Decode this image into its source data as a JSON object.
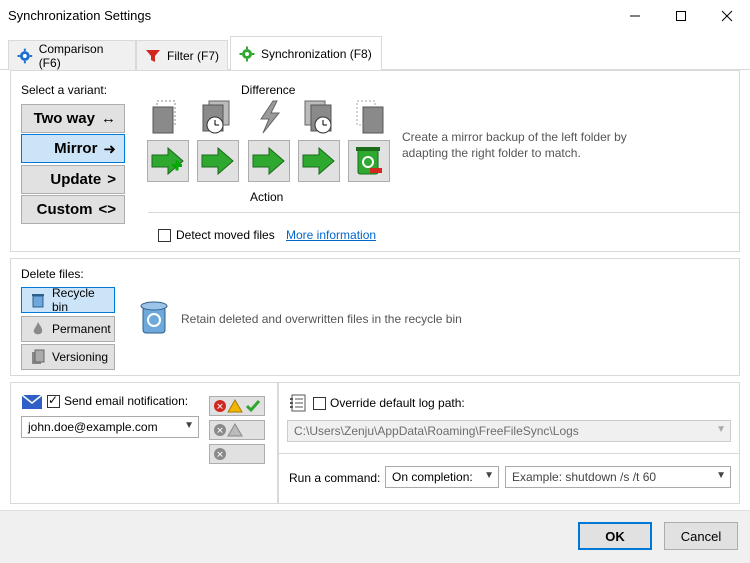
{
  "window": {
    "title": "Synchronization Settings"
  },
  "tabs": [
    {
      "label": "Comparison (F6)",
      "icon": "gear-icon"
    },
    {
      "label": "Filter (F7)",
      "icon": "filter-icon"
    },
    {
      "label": "Synchronization (F8)",
      "icon": "gear-icon"
    }
  ],
  "variant": {
    "heading": "Select a variant:",
    "options": [
      {
        "label": "Two way",
        "symbol": "↔"
      },
      {
        "label": "Mirror",
        "symbol": "➜"
      },
      {
        "label": "Update",
        "symbol": ">"
      },
      {
        "label": "Custom",
        "symbol": "<>"
      }
    ],
    "selected": "Mirror",
    "difference_label": "Difference",
    "action_label": "Action",
    "description_line1": "Create a mirror backup of the left folder by",
    "description_line2": "adapting the right folder to match."
  },
  "detect": {
    "label": "Detect moved files",
    "checked": false,
    "link": "More information"
  },
  "delete_files": {
    "heading": "Delete files:",
    "options": [
      "Recycle bin",
      "Permanent",
      "Versioning"
    ],
    "selected": "Recycle bin",
    "description": "Retain deleted and overwritten files in the recycle bin"
  },
  "email": {
    "label": "Send email notification:",
    "checked": true,
    "address": "john.doe@example.com"
  },
  "log": {
    "label": "Override default log path:",
    "checked": false,
    "path": "C:\\Users\\Zenju\\AppData\\Roaming\\FreeFileSync\\Logs",
    "command_label": "Run a command:",
    "command_when": "On completion:",
    "command_placeholder": "Example: shutdown /s /t 60"
  },
  "footer": {
    "ok": "OK",
    "cancel": "Cancel"
  },
  "colors": {
    "accent": "#0078d7",
    "selected_bg": "#cce4f7",
    "green": "#2fa82f"
  }
}
